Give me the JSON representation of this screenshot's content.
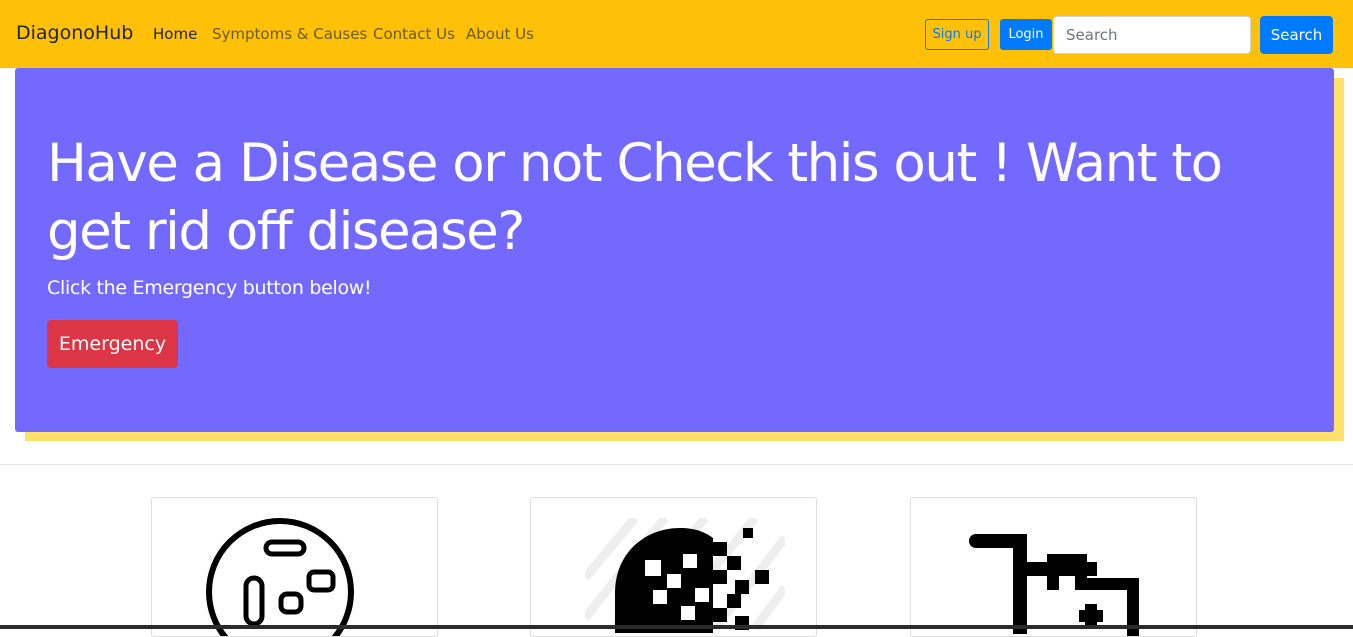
{
  "navbar": {
    "brand": "DiagonoHub",
    "links": [
      {
        "label": "Home",
        "active": true
      },
      {
        "label": "Symptoms & Causes",
        "active": false
      },
      {
        "label": "Contact Us",
        "active": false
      },
      {
        "label": "About Us",
        "active": false
      }
    ],
    "signup_label": "Sign up",
    "login_label": "Login",
    "search_placeholder": "Search",
    "search_button_label": "Search"
  },
  "hero": {
    "title": "Have a Disease or not Check this out ! Want to get rid off disease?",
    "subtitle": "Click the Emergency button below!",
    "button_label": "Emergency"
  },
  "cards": [
    {
      "icon": "bacteria-cell-icon"
    },
    {
      "icon": "head-disintegrating-icon"
    },
    {
      "icon": "wheelchair-medical-icon"
    }
  ],
  "colors": {
    "navbar_bg": "#ffc107",
    "hero_bg": "#7469ff",
    "hero_shadow": "#ffe06a",
    "primary": "#007bff",
    "danger": "#dc3545"
  }
}
